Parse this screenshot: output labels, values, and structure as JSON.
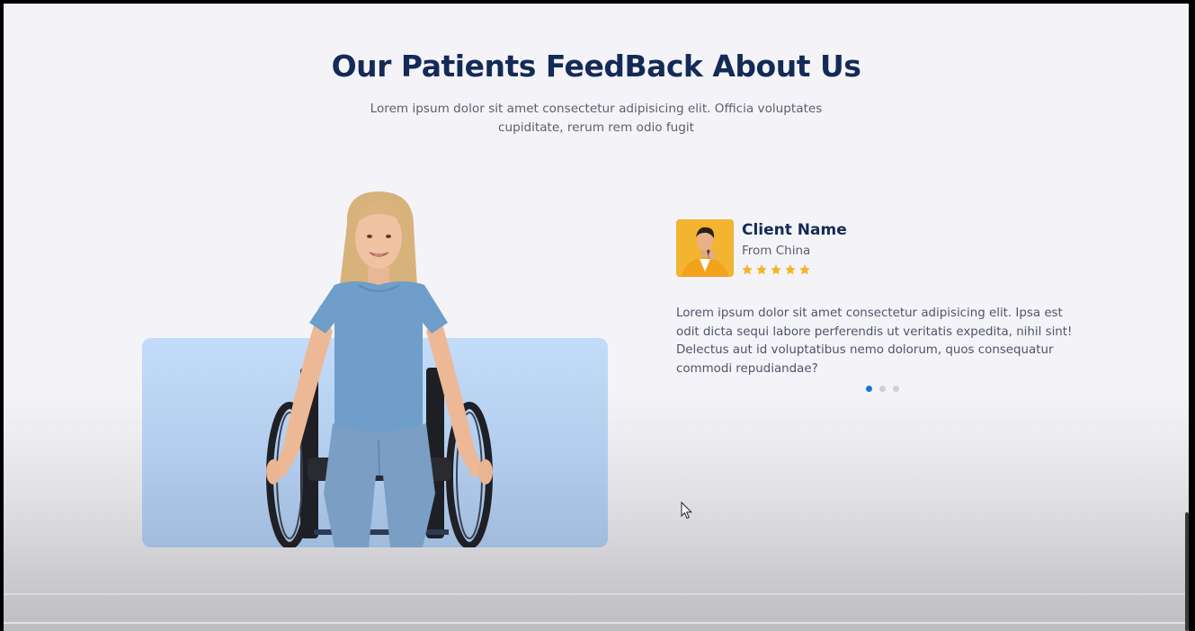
{
  "section": {
    "title": "Our Patients FeedBack About Us",
    "subtitle": "Lorem ipsum dolor sit amet consectetur adipisicing elit. Officia voluptates cupiditate, rerum rem odio fugit"
  },
  "testimonial": {
    "client_name": "Client Name",
    "client_origin": "From China",
    "rating": 5,
    "rating_max": 5,
    "quote": "Lorem ipsum dolor sit amet consectetur adipisicing elit. Ipsa est odit dicta sequi labore perferendis ut veritatis expedita, nihil sint! Delectus aut id voluptatibus nemo dolorum, quos consequatur commodi repudiandae?",
    "star_color": "#f5b52b",
    "avatar_background": "#f2b431"
  },
  "carousel": {
    "total_slides": 3,
    "active_slide": 1,
    "active_color": "#1a73d9",
    "inactive_color": "#cfd0d5"
  },
  "colors": {
    "heading": "#142a57",
    "body_text": "#5c5f6b",
    "card_background": "#c3dcfa"
  },
  "icons": {
    "star": "star-icon",
    "cursor": "mouse-pointer-icon"
  }
}
